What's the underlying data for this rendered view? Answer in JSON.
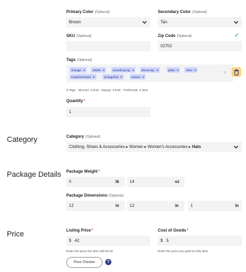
{
  "colors": {
    "tag_bg": "#cfd6ff",
    "tag_text": "#2b3a8a",
    "check": "#2bbf5a",
    "trash_bg": "#ffd37a"
  },
  "primary_color": {
    "label": "Primary Color",
    "opt": "(Optional)",
    "value": "Brown"
  },
  "secondary_color": {
    "label": "Secondary Color",
    "opt": "(Optional)",
    "value": "Tan"
  },
  "sku": {
    "label": "SKU",
    "opt": "(Optional)",
    "value": ""
  },
  "zip": {
    "label": "Zip Code",
    "opt": "(Optional)",
    "value": "02702"
  },
  "tags": {
    "label": "Tags",
    "opt": "(Optional)",
    "items": [
      "vintage",
      "1990s",
      "newsboycap",
      "drivercap",
      "plaid",
      "retro",
      "madeinireland",
      "vintagehat",
      "unisex"
    ],
    "hint": "9 Tags - Mercari: 3 limit - Depop: 5 limit - Poshmark: 3 limit"
  },
  "quantity": {
    "label": "Quantity",
    "req": "*",
    "value": "1"
  },
  "sections": {
    "category": "Category",
    "package": "Package Details",
    "price": "Price"
  },
  "category": {
    "label": "Category",
    "opt": "(Optional)",
    "path": "Clothing, Shoes & Accessories ▸ Women ▸ Women's Accessories ▸",
    "leaf": "Hats"
  },
  "weight": {
    "label": "Package Weight",
    "req": "*",
    "lb": "0",
    "lb_unit": "lb",
    "oz": "14",
    "oz_unit": "oz"
  },
  "dimensions": {
    "label": "Package Dimensions",
    "opt": "(Optional)",
    "l": "12",
    "w": "12",
    "h": "1",
    "unit": "in"
  },
  "listing_price": {
    "label": "Listing Price",
    "req": "*",
    "currency": "$",
    "value": "42",
    "hint": "Enter the price the item will list for"
  },
  "cost": {
    "label": "Cost of Goods",
    "req": "*",
    "currency": "$",
    "value": "5",
    "hint": "Enter the price you paid on this item."
  },
  "price_checker": "Price Checker",
  "help": "?"
}
